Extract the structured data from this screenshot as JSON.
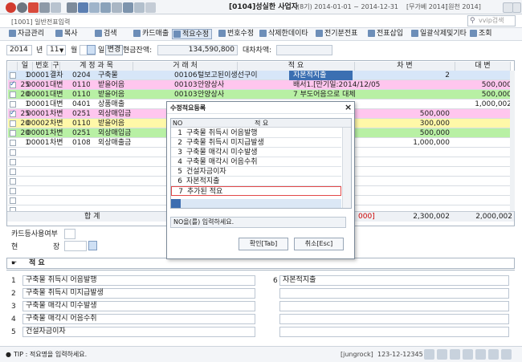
{
  "titlebar": {
    "company": "[0104]성실한 사업자",
    "period": "(8기) 2014-01-01 ~ 2014-12-31",
    "edition": "[무가베 2014]",
    "version": "[원천 2014]"
  },
  "screen": {
    "title": "[1001] 일반전표입력",
    "search_placeholder": "vvip검색"
  },
  "toolbar": [
    "자금관리",
    "복사",
    "검색",
    "카드매출",
    "적요수정",
    "번호수정",
    "삭제한데이타",
    "전기분전표",
    "전표삽입",
    "일괄삭제및기타",
    "조회"
  ],
  "filter": {
    "year": "2014",
    "year_label": "년",
    "month": "11",
    "month_label": "월",
    "day_label": "일",
    "change_label": "변경",
    "cash_label": "현금잔액:",
    "cash_value": "134,590,800",
    "diff_label": "대차차액:"
  },
  "grid": {
    "headers": [
      "일",
      "번호",
      "구분",
      "계 정 과 목",
      "거 래 처",
      "적 요",
      "차 변",
      "대 변"
    ],
    "rows": [
      {
        "checked": false,
        "day": "1",
        "no": "00001",
        "type": "결차",
        "code": "0204",
        "account": "구축물",
        "vcode": "00106",
        "vendor": "털보고된이생선구이",
        "memo": "자본적지출",
        "debit": "2",
        "credit": "",
        "color": "#d7e6f8"
      },
      {
        "checked": true,
        "day": "25",
        "no": "00001",
        "type": "대변",
        "code": "0110",
        "account": "받을어음",
        "vcode": "00103",
        "vendor": "안양상사",
        "memo": "배서1.[만기일:2014/12/05",
        "debit": "",
        "credit": "500,000",
        "color": "#ffc6ee"
      },
      {
        "checked": false,
        "day": "20",
        "no": "00001",
        "type": "대변",
        "code": "0110",
        "account": "받을어음",
        "vcode": "00103",
        "vendor": "안양상사",
        "memo": "7 부도어음으로 대체",
        "debit": "",
        "credit": "500,000",
        "color": "#b8f0a4"
      },
      {
        "checked": false,
        "day": "1",
        "no": "00001",
        "type": "대변",
        "code": "0401",
        "account": "상품매출",
        "vcode": "",
        "vendor": "",
        "memo": "",
        "debit": "",
        "credit": "1,000,002",
        "color": "#ffffff"
      },
      {
        "checked": true,
        "day": "25",
        "no": "00001",
        "type": "차변",
        "code": "0251",
        "account": "외상매입금",
        "vcode": "",
        "vendor": "",
        "memo": "",
        "debit": "500,000",
        "credit": "",
        "color": "#ffc6ee"
      },
      {
        "checked": false,
        "day": "20",
        "no": "00002",
        "type": "차변",
        "code": "0110",
        "account": "받을어음",
        "vcode": "",
        "vendor": "",
        "memo": "어음수취",
        "debit": "300,000",
        "credit": "",
        "color": "#fff8a8"
      },
      {
        "checked": false,
        "day": "20",
        "no": "00001",
        "type": "차변",
        "code": "0251",
        "account": "외상매입금",
        "vcode": "",
        "vendor": "",
        "memo": "",
        "debit": "500,000",
        "credit": "",
        "color": "#b8f0a4"
      },
      {
        "checked": false,
        "day": "1",
        "no": "00001",
        "type": "차변",
        "code": "0108",
        "account": "외상매출금",
        "vcode": "",
        "vendor": "",
        "memo": "",
        "debit": "1,000,000",
        "credit": "",
        "color": "#ffffff"
      }
    ],
    "total_label": "합     계",
    "total_mid": "000]",
    "total_debit": "2,300,002",
    "total_credit": "2,000,002"
  },
  "card_label": "카드등사용여부",
  "cash_label": "현",
  "cash_label2": "장",
  "memo_section": {
    "title": "적 요",
    "left": [
      {
        "no": "1",
        "text": "구축물 취득시 어음발행"
      },
      {
        "no": "2",
        "text": "구축물 취득시 미지급발생"
      },
      {
        "no": "3",
        "text": "구축물 매각시 미수발생"
      },
      {
        "no": "4",
        "text": "구축물 매각시 어음수취"
      },
      {
        "no": "5",
        "text": "건설자금이자"
      }
    ],
    "right": [
      {
        "no": "6",
        "text": "자본적지출"
      }
    ]
  },
  "status": {
    "tip": "TIP : 적요명을 입력하세요.",
    "user": "[jungrock]",
    "date": "123-12-12345"
  },
  "dialog": {
    "title": "수정적요등록",
    "col_no": "NO",
    "col_memo": "적 요",
    "items": [
      {
        "no": "1",
        "text": "구축물 취득시 어음발행"
      },
      {
        "no": "2",
        "text": "구축물 취득시 미지급발생"
      },
      {
        "no": "3",
        "text": "구축물 매각시 미수발생"
      },
      {
        "no": "4",
        "text": "구축물 매각시 어음수취"
      },
      {
        "no": "5",
        "text": "건설자금이자"
      },
      {
        "no": "6",
        "text": "자본적지출"
      },
      {
        "no": "7",
        "text": "추가된 적요"
      }
    ],
    "message": "NO을(를) 입력하세요.",
    "ok": "확인[Tab]",
    "cancel": "취소[Esc]",
    "close": "×"
  }
}
